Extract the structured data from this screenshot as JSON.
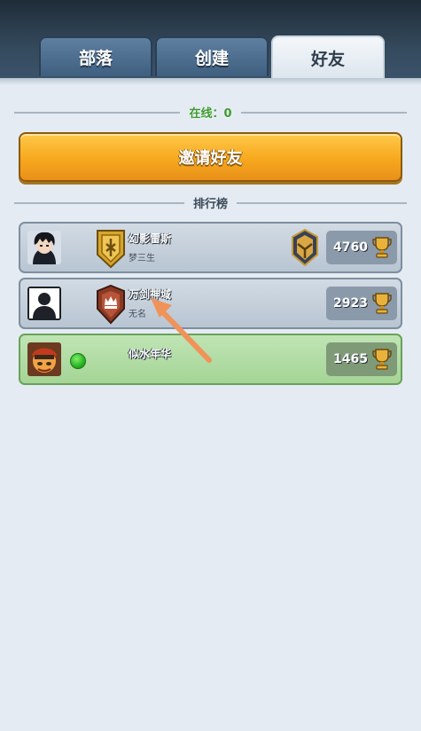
{
  "tabs": [
    {
      "label": "部落",
      "active": false
    },
    {
      "label": "创建",
      "active": false
    },
    {
      "label": "好友",
      "active": true
    }
  ],
  "online_label": "在线：0",
  "invite_label": "邀请好友",
  "ranking_title": "排行榜",
  "friends": [
    {
      "name": "幻影雷斯",
      "clan": "梦三生",
      "trophies": "4760",
      "online": false
    },
    {
      "name": "万剑神域",
      "clan": "无名",
      "trophies": "2923",
      "online": false
    },
    {
      "name": "似水年华",
      "clan": "",
      "trophies": "1465",
      "online": true
    }
  ],
  "colors": {
    "invite_button": "#f7a81e",
    "online_text": "#3b9b2e",
    "self_row": "#b4dea6",
    "arrow": "#f0935a"
  }
}
